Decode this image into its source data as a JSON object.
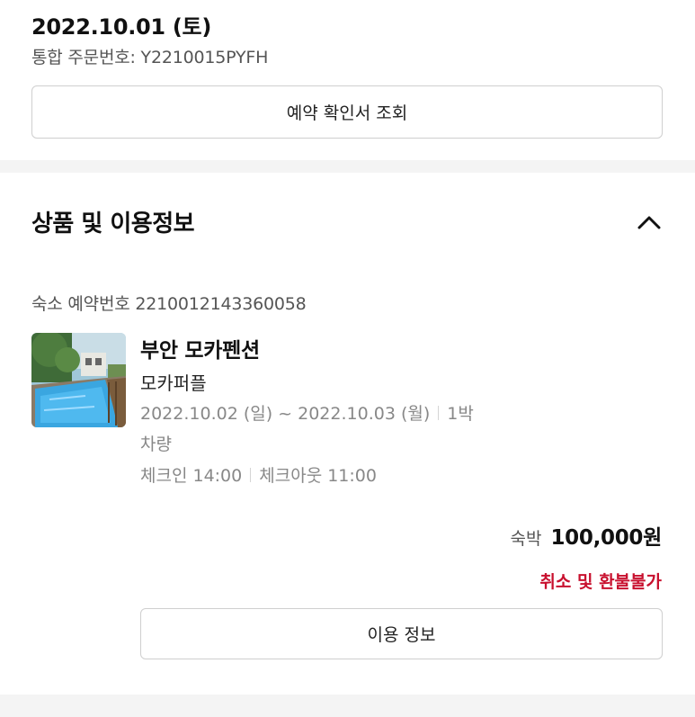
{
  "order": {
    "date": "2022.10.01 (토)",
    "number_text": "통합 주문번호: Y2210015PYFH",
    "confirm_button": "예약 확인서 조회"
  },
  "product_section": {
    "title": "상품 및 이용정보",
    "collapse_icon": "chevron-up-icon",
    "lodging_reservation_text": "숙소 예약번호 2210012143360058",
    "item": {
      "thumbnail": "pool-pension-photo",
      "name": "부안 모카펜션",
      "room": "모카퍼플",
      "stay_dates": "2022.10.02 (일) ~ 2022.10.03 (월)",
      "nights": "1박",
      "vehicle": "차량",
      "check_in": "체크인 14:00",
      "check_out": "체크아웃 11:00"
    },
    "price_label": "숙박",
    "price_value": "100,000원",
    "refund_policy": "취소 및 환불불가",
    "usage_button": "이용 정보"
  },
  "colors": {
    "accent_red": "#c8102e",
    "muted_text": "#888888",
    "divider": "#f4f4f4"
  }
}
